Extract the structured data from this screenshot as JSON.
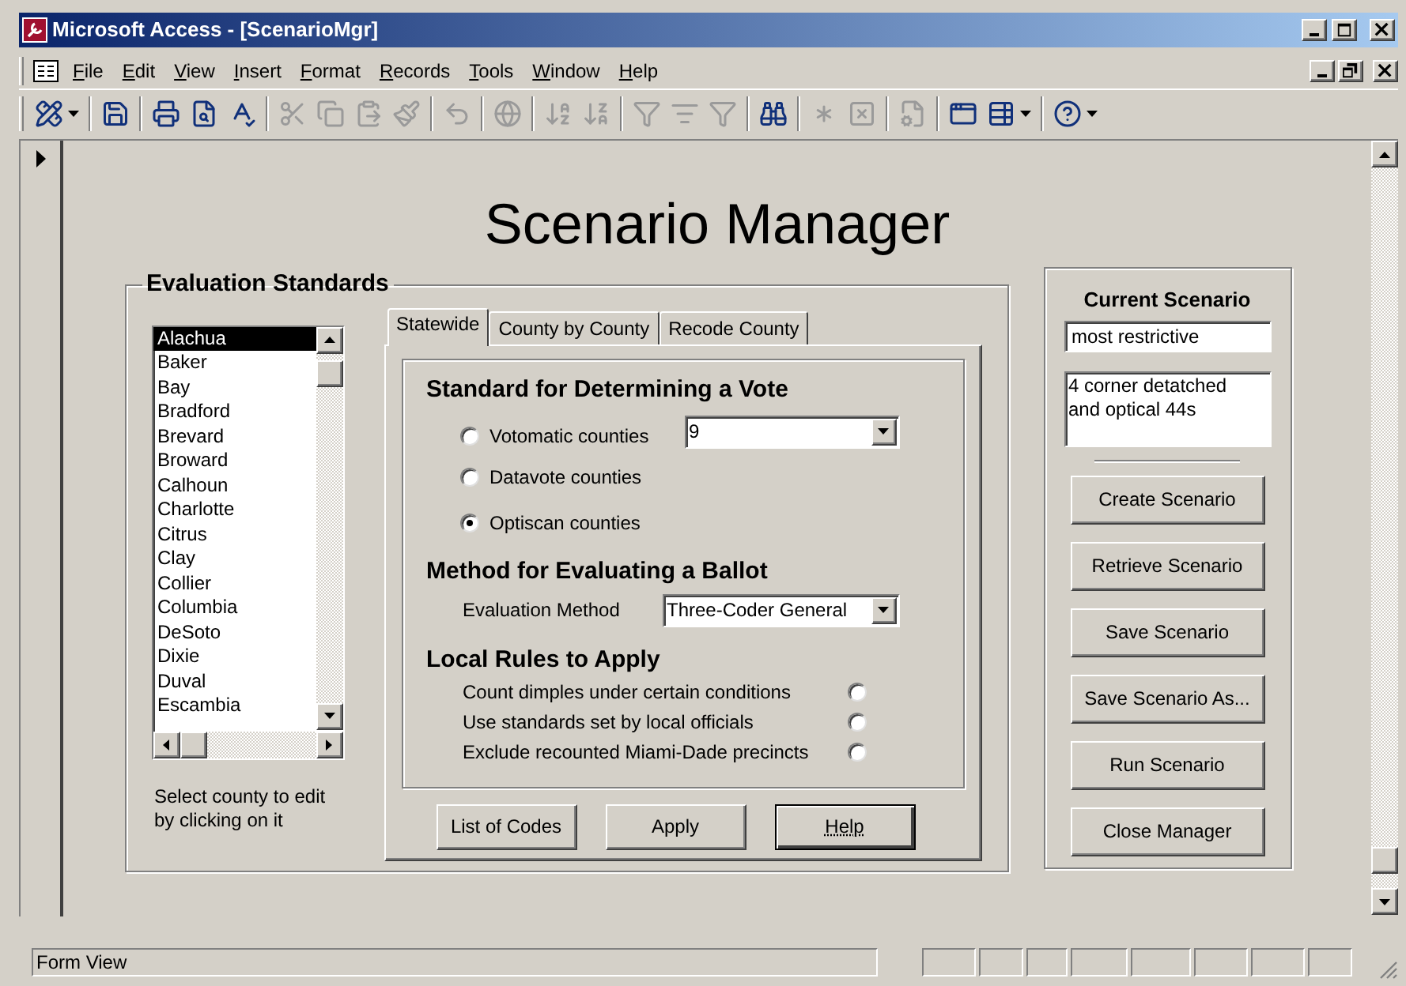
{
  "window": {
    "title": "Microsoft Access - [ScenarioMgr]"
  },
  "menu": [
    "File",
    "Edit",
    "View",
    "Insert",
    "Format",
    "Records",
    "Tools",
    "Window",
    "Help"
  ],
  "toolbar": [
    [
      {
        "kind": "view",
        "disabled": false,
        "dropdown": true
      }
    ],
    [
      {
        "kind": "save",
        "disabled": false,
        "dropdown": false
      }
    ],
    [
      {
        "kind": "print",
        "disabled": false,
        "dropdown": false
      },
      {
        "kind": "preview",
        "disabled": false,
        "dropdown": false
      },
      {
        "kind": "spelling",
        "disabled": false,
        "dropdown": false
      }
    ],
    [
      {
        "kind": "cut",
        "disabled": true,
        "dropdown": false
      },
      {
        "kind": "copy",
        "disabled": true,
        "dropdown": false
      },
      {
        "kind": "paste",
        "disabled": true,
        "dropdown": false
      },
      {
        "kind": "format_painter",
        "disabled": true,
        "dropdown": false
      }
    ],
    [
      {
        "kind": "undo",
        "disabled": true,
        "dropdown": false
      }
    ],
    [
      {
        "kind": "hyperlink",
        "disabled": true,
        "dropdown": false
      }
    ],
    [
      {
        "kind": "sort_asc",
        "disabled": true,
        "dropdown": false
      },
      {
        "kind": "sort_desc",
        "disabled": true,
        "dropdown": false
      }
    ],
    [
      {
        "kind": "filter_selection",
        "disabled": true,
        "dropdown": false
      },
      {
        "kind": "filter_form",
        "disabled": true,
        "dropdown": false
      },
      {
        "kind": "apply_filter",
        "disabled": true,
        "dropdown": false
      }
    ],
    [
      {
        "kind": "find",
        "disabled": false,
        "dropdown": false
      }
    ],
    [
      {
        "kind": "new_record",
        "disabled": true,
        "dropdown": false
      },
      {
        "kind": "delete_record",
        "disabled": true,
        "dropdown": false
      }
    ],
    [
      {
        "kind": "properties",
        "disabled": true,
        "dropdown": false
      }
    ],
    [
      {
        "kind": "database_window",
        "disabled": false,
        "dropdown": false
      },
      {
        "kind": "new_object",
        "disabled": false,
        "dropdown": true
      }
    ],
    [
      {
        "kind": "help",
        "disabled": false,
        "dropdown": true
      }
    ]
  ],
  "form": {
    "title": "Scenario Manager",
    "evaluation_standards": {
      "label": "Evaluation Standards",
      "counties": [
        {
          "name": "Alachua",
          "selected": true
        },
        {
          "name": "Baker",
          "selected": false
        },
        {
          "name": "Bay",
          "selected": false
        },
        {
          "name": "Bradford",
          "selected": false
        },
        {
          "name": "Brevard",
          "selected": false
        },
        {
          "name": "Broward",
          "selected": false
        },
        {
          "name": "Calhoun",
          "selected": false
        },
        {
          "name": "Charlotte",
          "selected": false
        },
        {
          "name": "Citrus",
          "selected": false
        },
        {
          "name": "Clay",
          "selected": false
        },
        {
          "name": "Collier",
          "selected": false
        },
        {
          "name": "Columbia",
          "selected": false
        },
        {
          "name": "DeSoto",
          "selected": false
        },
        {
          "name": "Dixie",
          "selected": false
        },
        {
          "name": "Duval",
          "selected": false
        },
        {
          "name": "Escambia",
          "selected": false
        }
      ],
      "hint": "Select county to edit by clicking on it",
      "tabs": [
        {
          "label": "Statewide",
          "selected": true
        },
        {
          "label": "County by County",
          "selected": false
        },
        {
          "label": "Recode County",
          "selected": false
        }
      ],
      "vote_standard": {
        "heading": "Standard for Determining a Vote",
        "options": [
          {
            "label": "Votomatic counties",
            "selected": false
          },
          {
            "label": "Datavote counties",
            "selected": false
          },
          {
            "label": "Optiscan counties",
            "selected": true
          }
        ],
        "value": "9"
      },
      "ballot_method": {
        "heading": "Method for Evaluating a Ballot",
        "label": "Evaluation Method",
        "value": "Three-Coder General"
      },
      "local_rules": {
        "heading": "Local Rules to Apply",
        "rules": [
          {
            "label": "Count dimples under certain conditions",
            "selected": false
          },
          {
            "label": "Use standards set by local officials",
            "selected": false
          },
          {
            "label": "Exclude recounted Miami-Dade precincts",
            "selected": false
          }
        ]
      },
      "buttons": [
        {
          "label": "List of Codes",
          "focused": false
        },
        {
          "label": "Apply",
          "focused": false
        },
        {
          "label": "Help",
          "focused": true
        }
      ]
    },
    "current_scenario": {
      "heading": "Current Scenario",
      "name": "most restrictive",
      "description": "4 corner detatched\nand optical 44s",
      "buttons": [
        "Create Scenario",
        "Retrieve Scenario",
        "Save Scenario",
        "Save Scenario As...",
        "Run Scenario",
        "Close Manager"
      ]
    }
  },
  "status_bar": {
    "text": "Form View"
  }
}
